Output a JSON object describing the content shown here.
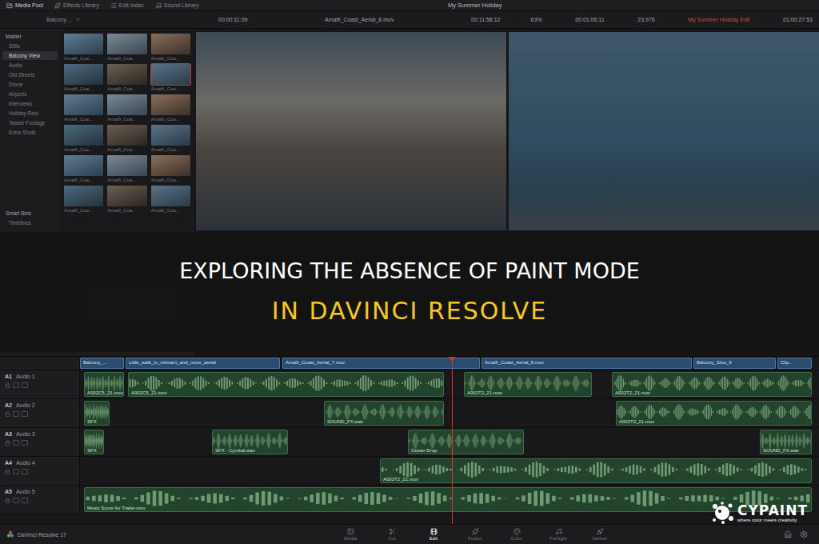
{
  "window": {
    "title": "My Summer Holiday"
  },
  "top_tabs": [
    {
      "label": "Media Pool",
      "selected": true
    },
    {
      "label": "Effects Library",
      "selected": false
    },
    {
      "label": "Edit Index",
      "selected": false
    },
    {
      "label": "Sound Library",
      "selected": false
    }
  ],
  "viewer_bar": {
    "bin": "Balcony ...",
    "source_duration": "00:00:11:09",
    "source_clip": "Amalfi_Coast_Aerial_8.mov",
    "source_timecode": "00:11:58:12",
    "timeline_zoom": "63%",
    "timeline_duration": "00:01:06:11",
    "frame_rate": "23.976",
    "timeline_name": "My Summer Holiday Edit",
    "timeline_timecode": "01:00:27:53"
  },
  "bins": {
    "header": "Master",
    "items": [
      {
        "label": "Stills",
        "selected": false
      },
      {
        "label": "Balcony View",
        "selected": true
      },
      {
        "label": "Audio",
        "selected": false
      },
      {
        "label": "Old Streets",
        "selected": false
      },
      {
        "label": "Drone",
        "selected": false
      },
      {
        "label": "Airports",
        "selected": false
      },
      {
        "label": "Interviews",
        "selected": false
      },
      {
        "label": "Holiday Reel",
        "selected": false
      },
      {
        "label": "Teaser Footage",
        "selected": false
      },
      {
        "label": "Extra Shots",
        "selected": false
      }
    ]
  },
  "smart_bins": {
    "header": "Smart Bins",
    "items": [
      "Timelines"
    ]
  },
  "media": [
    {
      "label": "Amalfi_Coa...",
      "selected": false
    },
    {
      "label": "Amalfi_Coa...",
      "selected": false
    },
    {
      "label": "Amalfi_Coa...",
      "selected": false
    },
    {
      "label": "Amalfi_Coa...",
      "selected": false
    },
    {
      "label": "Amalfi_Coa...",
      "selected": false
    },
    {
      "label": "Amalfi_Coa...",
      "selected": true
    },
    {
      "label": "Amalfi_Coa...",
      "selected": false
    },
    {
      "label": "Amalfi_Coa...",
      "selected": false
    },
    {
      "label": "Amalfi_Coa...",
      "selected": false
    },
    {
      "label": "Amalfi_Coa...",
      "selected": false
    },
    {
      "label": "Amalfi_Coa...",
      "selected": false
    },
    {
      "label": "Amalfi_Coa...",
      "selected": false
    },
    {
      "label": "Amalfi_Coa...",
      "selected": false
    },
    {
      "label": "Amalfi_Coa...",
      "selected": false
    },
    {
      "label": "Amalfi_Coa...",
      "selected": false
    },
    {
      "label": "Amalfi_Coa...",
      "selected": false
    },
    {
      "label": "Amalfi_Coa...",
      "selected": false
    },
    {
      "label": "Amalfi_Coa...",
      "selected": false
    }
  ],
  "video_track": {
    "clips": [
      "Balcony_...",
      "Little_walk_in_vietnam_and_more_aerial",
      "Amalfi_Coast_Aerial_7.mov",
      "Amalfi_Coast_Aerial_8.mov",
      "Balcony_Shot_9",
      "Clip..."
    ]
  },
  "audio_tracks": [
    {
      "id": "A1",
      "name": "Audio 1",
      "clips": [
        "A002C5_21.mov",
        "A002C5_21.mov",
        "A002T2_21.mov",
        "A002T2_21.mov"
      ]
    },
    {
      "id": "A2",
      "name": "Audio 2",
      "clips": [
        "SFX",
        "SOUND_FX.wav",
        "A002T2_21.mov"
      ]
    },
    {
      "id": "A3",
      "name": "Audio 3",
      "clips": [
        "SFX",
        "SFX - Cymbal.wav",
        "Ocean Drop",
        "SOUND_FX.wav"
      ]
    },
    {
      "id": "A4",
      "name": "Audio 4",
      "clips": [
        "A002T2_21.mov"
      ]
    },
    {
      "id": "A5",
      "name": "Audio 5",
      "clips": [
        "Music Score for Trailer.mov"
      ]
    }
  ],
  "pages": [
    {
      "label": "Media",
      "selected": false
    },
    {
      "label": "Cut",
      "selected": false
    },
    {
      "label": "Edit",
      "selected": true
    },
    {
      "label": "Fusion",
      "selected": false
    },
    {
      "label": "Color",
      "selected": false
    },
    {
      "label": "Fairlight",
      "selected": false
    },
    {
      "label": "Deliver",
      "selected": false
    }
  ],
  "app": {
    "name": "DaVinci Resolve 17"
  },
  "banner": {
    "line1": "EXPLORING THE ABSENCE OF PAINT MODE",
    "line2": "IN DAVINCI RESOLVE"
  },
  "logo": {
    "name": "CYPAINT",
    "tagline": "where color meets creativity"
  }
}
